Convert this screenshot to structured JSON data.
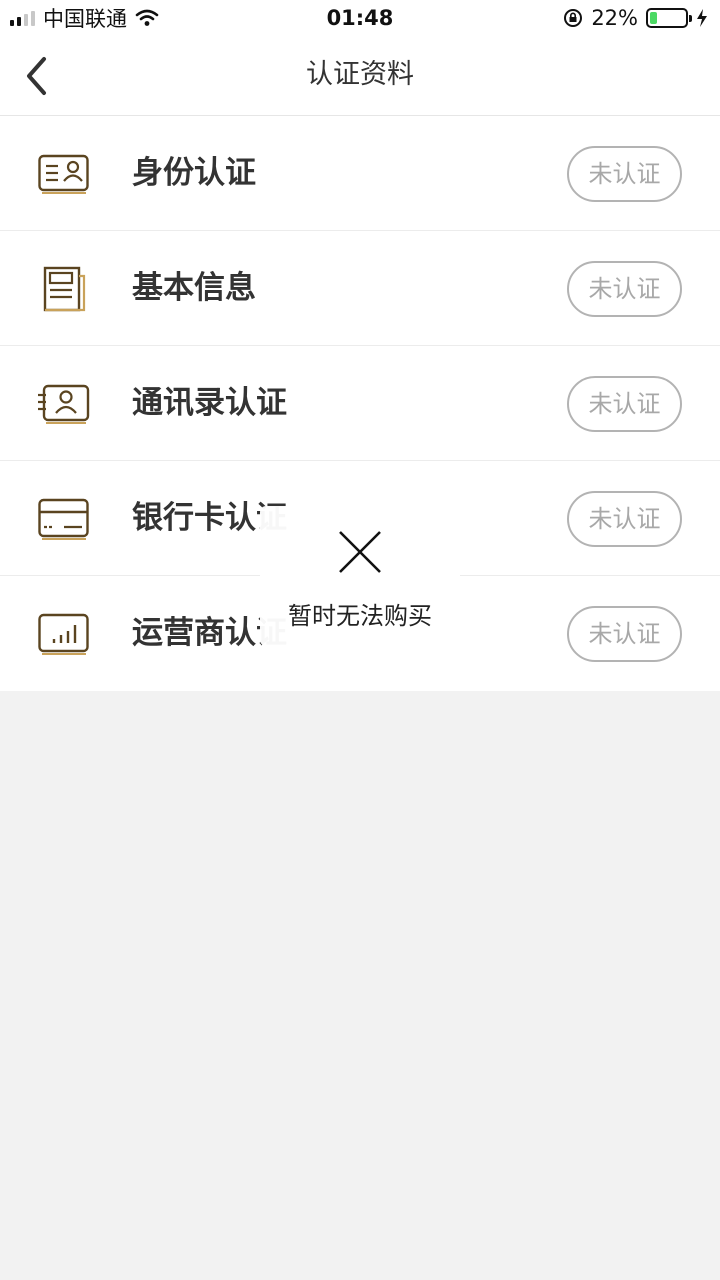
{
  "status_bar": {
    "carrier": "中国联通",
    "time": "01:48",
    "battery_percent": "22%",
    "battery_level": 0.22
  },
  "header": {
    "title": "认证资料",
    "back_icon": "chevron-left-icon"
  },
  "items": [
    {
      "label": "身份认证",
      "status": "未认证",
      "icon": "id-card-icon"
    },
    {
      "label": "基本信息",
      "status": "未认证",
      "icon": "document-icon"
    },
    {
      "label": "通讯录认证",
      "status": "未认证",
      "icon": "contact-card-icon"
    },
    {
      "label": "银行卡认证",
      "status": "未认证",
      "icon": "bank-card-icon"
    },
    {
      "label": "运营商认证",
      "status": "未认证",
      "icon": "signal-bars-icon"
    }
  ],
  "toast": {
    "message": "暂时无法购买",
    "icon": "close-icon"
  },
  "colors": {
    "icon_stroke": "#5a4420",
    "icon_accent": "#c9a25a",
    "badge_border": "#b3b3b3",
    "background": "#f2f2f2"
  }
}
